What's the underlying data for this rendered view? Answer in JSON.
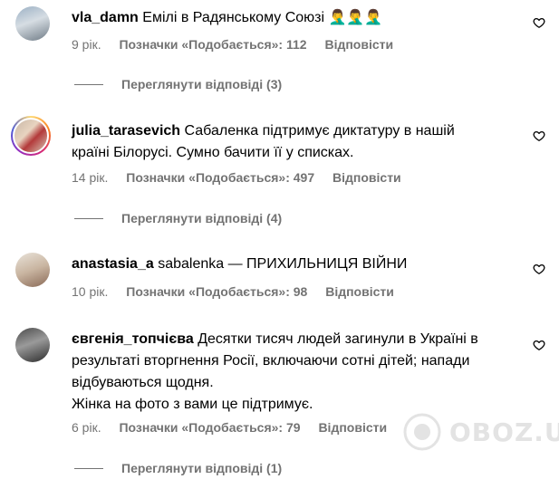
{
  "comments": [
    {
      "username": "vla_damn",
      "text": "Емілі в Радянському Союзі 🤦‍♂️🤦‍♂️🤦‍♂️",
      "time": "9 рік.",
      "likes": "Позначки «Подобається»: 112",
      "reply": "Відповісти",
      "view_replies": "Переглянути відповіді (3)"
    },
    {
      "username": "julia_tarasevich",
      "text": "Сабаленка підтримує диктатуру в нашій",
      "text_line2": "країні Білорусі. Сумно бачити її у списках.",
      "time": "14 рік.",
      "likes": "Позначки «Подобається»: 497",
      "reply": "Відповісти",
      "view_replies": "Переглянути відповіді (4)"
    },
    {
      "username": "anastasia_a",
      "text": "sabalenka — ПРИХИЛЬНИЦЯ ВІЙНИ",
      "time": "10 рік.",
      "likes": "Позначки «Подобається»: 98",
      "reply": "Відповісти"
    },
    {
      "username": "євгенія_топчієва",
      "text": "Десятки тисяч людей загинули в Україні в",
      "text_line2": "результаті вторгнення Росії, включаючи сотні дітей; напади",
      "text_line3": "відбуваються щодня.",
      "text_line4": "Жінка на фото з вами це підтримує.",
      "time": "6 рік.",
      "likes": "Позначки «Подобається»: 79",
      "reply": "Відповісти",
      "view_replies": "Переглянути відповіді (1)"
    }
  ],
  "watermark": "OBOZ.UA",
  "icons": {
    "like": "heart-icon"
  },
  "colors": {
    "meta": "#737373",
    "text": "#000000"
  }
}
